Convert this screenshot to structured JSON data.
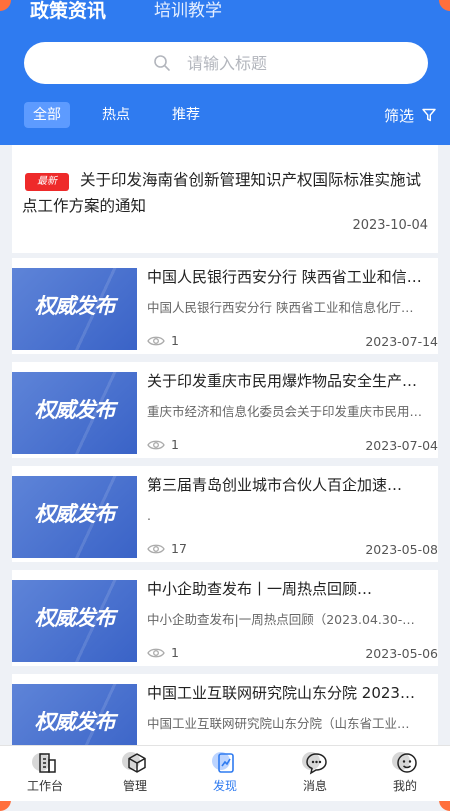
{
  "top_tabs": [
    "政策资讯",
    "培训教学"
  ],
  "search": {
    "placeholder": "请输入标题"
  },
  "filters": {
    "all": "全部",
    "hot": "热点",
    "recommend": "推荐",
    "screen": "筛选"
  },
  "featured": {
    "badge": "最新",
    "title": "关于印发海南省创新管理知识产权国际标准实施试点工作方案的通知",
    "date": "2023-10-04"
  },
  "thumb_text": "权威发布",
  "news": [
    {
      "title": "中国人民银行西安分行 陕西省工业和信息化厅…",
      "desc": "中国人民银行西安分行 陕西省工业和信息化厅…",
      "views": "1",
      "date": "2023-07-14"
    },
    {
      "title": "关于印发重庆市民用爆炸物品安全生产…",
      "desc": "重庆市经济和信息化委员会关于印发重庆市民用…",
      "views": "1",
      "date": "2023-07-04"
    },
    {
      "title": "第三届青岛创业城市合伙人百企加速…",
      "desc": ".",
      "views": "17",
      "date": "2023-05-08"
    },
    {
      "title": "中小企助查发布丨一周热点回顾…",
      "desc": "中小企助查发布|一周热点回顾（2023.04.30-…",
      "views": "1",
      "date": "2023-05-06"
    },
    {
      "title": "中国工业互联网研究院山东分院 2023…",
      "desc": "中国工业互联网研究院山东分院（山东省工业…",
      "views": "",
      "date": ""
    }
  ],
  "nav": [
    {
      "label": "工作台",
      "icon": "building-icon"
    },
    {
      "label": "管理",
      "icon": "cube-icon"
    },
    {
      "label": "发现",
      "icon": "discover-icon"
    },
    {
      "label": "消息",
      "icon": "message-icon"
    },
    {
      "label": "我的",
      "icon": "profile-icon"
    }
  ],
  "colors": {
    "header": "#2f7bf0",
    "badge": "#ee2a2a",
    "thumb": "#4a72d0",
    "active_nav": "#2f7bf0"
  }
}
